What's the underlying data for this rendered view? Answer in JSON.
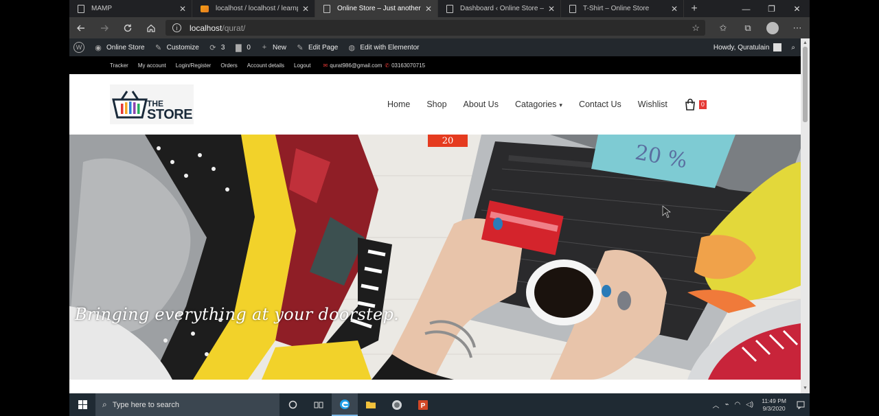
{
  "browser": {
    "tabs": [
      {
        "title": "MAMP",
        "active": false,
        "icon": "page-icon"
      },
      {
        "title": "localhost / localhost / learnp",
        "active": false,
        "icon": "phpmyadmin-icon"
      },
      {
        "title": "Online Store – Just another W",
        "active": true,
        "icon": "page-icon"
      },
      {
        "title": "Dashboard ‹ Online Store — V",
        "active": false,
        "icon": "page-icon"
      },
      {
        "title": "T-Shirt – Online Store",
        "active": false,
        "icon": "page-icon"
      }
    ],
    "new_tab": "+",
    "url_host": "localhost",
    "url_path": "/qurat/",
    "window_controls": {
      "minimize": "—",
      "restore": "❐",
      "close": "✕"
    }
  },
  "adminbar": {
    "site_name": "Online Store",
    "customize": "Customize",
    "updates_count": "3",
    "comments_count": "0",
    "new": "New",
    "edit_page": "Edit Page",
    "elementor": "Edit with Elementor",
    "howdy": "Howdy, Quratulain"
  },
  "topbar": {
    "links": [
      "Tracker",
      "My account",
      "Login/Register",
      "Orders",
      "Account details",
      "Logout"
    ],
    "email": "qurat986@gmail.com",
    "phone": "03163070715"
  },
  "header": {
    "logo_the": "THE",
    "logo_store": "STORE",
    "nav": {
      "home": "Home",
      "shop": "Shop",
      "about": "About Us",
      "categories": "Catagories",
      "contact": "Contact Us",
      "wishlist": "Wishlist"
    },
    "cart_count": "0"
  },
  "hero": {
    "tagline": "Bringing everything at your doorstep.",
    "sale_text": "20 %",
    "red_tag": "20"
  },
  "taskbar": {
    "search_placeholder": "Type here to search",
    "time": "11:49 PM",
    "date": "9/3/2020"
  },
  "colors": {
    "accent_red": "#e53935",
    "admin_bar": "#23282d",
    "taskbar": "#1f2a33"
  }
}
